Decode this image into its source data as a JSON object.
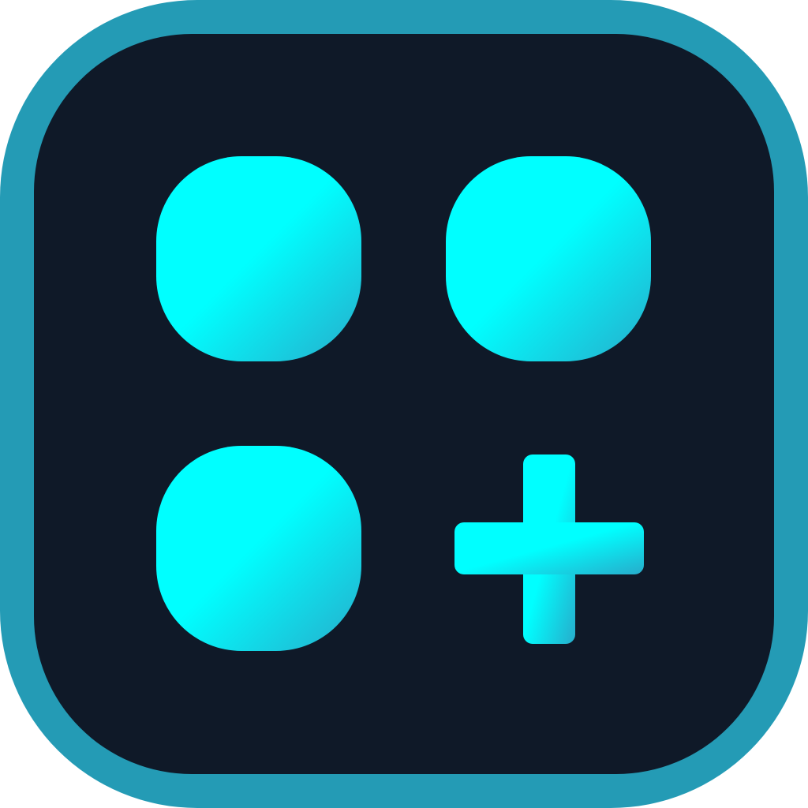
{
  "icon": {
    "name": "add-widget-app-icon",
    "colors": {
      "frame": "#249BB5",
      "background": "#0F1928",
      "tile_gradient_start": "#00FFFF",
      "tile_gradient_end": "#27ACCB"
    },
    "glyphs": [
      "rounded-square-tile",
      "rounded-square-tile",
      "rounded-square-tile",
      "plus-icon"
    ]
  }
}
